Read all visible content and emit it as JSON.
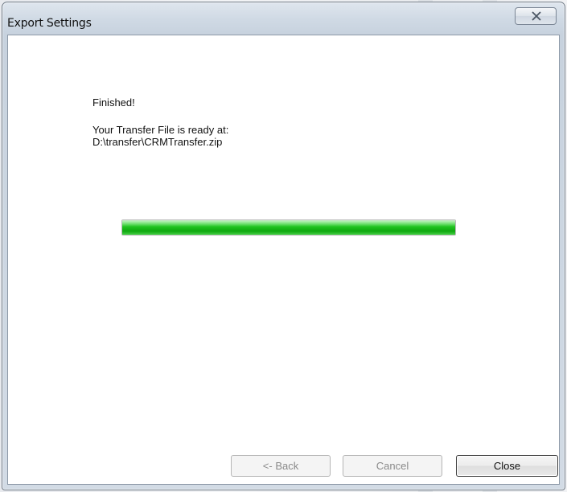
{
  "window": {
    "title": "Export Settings"
  },
  "content": {
    "status": "Finished!",
    "message_line1": "Your Transfer File is ready at:",
    "file_path": "D:\\transfer\\CRMTransfer.zip"
  },
  "progress": {
    "percent": 100,
    "color": "#1fc31f"
  },
  "buttons": {
    "back": "<- Back",
    "cancel": "Cancel",
    "close": "Close"
  },
  "icons": {
    "window_close": "close-icon"
  }
}
